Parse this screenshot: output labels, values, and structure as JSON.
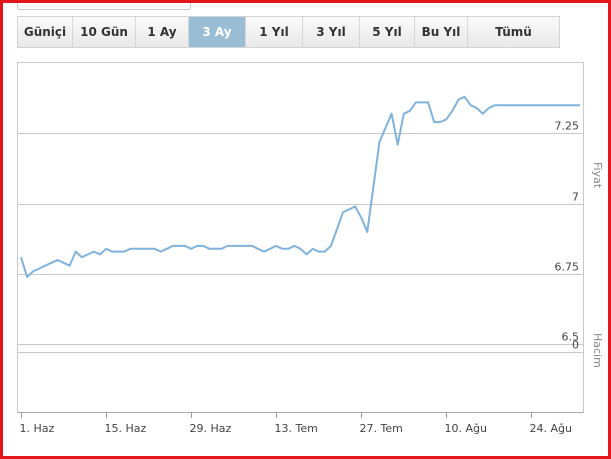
{
  "range_selector": {
    "buttons": [
      {
        "label": "Güniçi"
      },
      {
        "label": "10 Gün"
      },
      {
        "label": "1 Ay"
      },
      {
        "label": "3 Ay"
      },
      {
        "label": "1 Yıl"
      },
      {
        "label": "3 Yıl"
      },
      {
        "label": "5 Yıl"
      },
      {
        "label": "Bu Yıl"
      },
      {
        "label": "Tümü"
      }
    ],
    "active": "3 Ay"
  },
  "colors": {
    "line": "#7fb3dd",
    "active_button": "#98bdd4",
    "frame": "#e3161c",
    "grid": "#c8c8c8"
  },
  "side_labels": {
    "price_axis": "Fiyat",
    "volume_axis": "Hacim"
  },
  "chart_data": {
    "type": "line",
    "title": "",
    "xlabel": "",
    "ylabel": "Fiyat",
    "price_ticks": [
      {
        "label": "7.25",
        "value": 7.25
      },
      {
        "label": "7",
        "value": 7.0
      },
      {
        "label": "6.75",
        "value": 6.75
      },
      {
        "label": "6.5",
        "value": 6.5
      }
    ],
    "volume_ticks": [
      {
        "label": "0",
        "value": 0
      }
    ],
    "ylim": [
      6.26,
      7.5
    ],
    "x_ticks": [
      "1. Haz",
      "15. Haz",
      "29. Haz",
      "13. Tem",
      "27. Tem",
      "10. Ağu",
      "24. Ağu"
    ],
    "x_tick_days": [
      0,
      14,
      28,
      42,
      56,
      70,
      84
    ],
    "xlim_days": [
      -0.5,
      92.5
    ],
    "grid": true,
    "series": [
      {
        "days": [
          0,
          1,
          2,
          3,
          4,
          5,
          6,
          7,
          8,
          9,
          10,
          11,
          12,
          13,
          14,
          15,
          16,
          17,
          18,
          19,
          20,
          21,
          22,
          23,
          24,
          25,
          26,
          27,
          28,
          29,
          30,
          31,
          32,
          33,
          34,
          35,
          36,
          37,
          38,
          39,
          40,
          41,
          42,
          43,
          44,
          45,
          46,
          47,
          48,
          49,
          50,
          51,
          52,
          53,
          54,
          55,
          56,
          57,
          58,
          59,
          60,
          61,
          62,
          63,
          64,
          65,
          66,
          67,
          68,
          69,
          70,
          71,
          72,
          73,
          74,
          75,
          76,
          77,
          78,
          79,
          80,
          81,
          82,
          83,
          84,
          85,
          86,
          87,
          88,
          89,
          90,
          91,
          92
        ],
        "values": [
          6.81,
          6.74,
          6.76,
          6.77,
          6.78,
          6.79,
          6.8,
          6.79,
          6.78,
          6.83,
          6.81,
          6.82,
          6.83,
          6.82,
          6.84,
          6.83,
          6.83,
          6.83,
          6.84,
          6.84,
          6.84,
          6.84,
          6.84,
          6.83,
          6.84,
          6.85,
          6.85,
          6.85,
          6.84,
          6.85,
          6.85,
          6.84,
          6.84,
          6.84,
          6.85,
          6.85,
          6.85,
          6.85,
          6.85,
          6.84,
          6.83,
          6.84,
          6.85,
          6.84,
          6.84,
          6.85,
          6.84,
          6.82,
          6.84,
          6.83,
          6.83,
          6.85,
          6.91,
          6.97,
          6.98,
          6.99,
          6.95,
          6.9,
          7.06,
          7.22,
          7.27,
          7.32,
          7.21,
          7.32,
          7.33,
          7.36,
          7.36,
          7.36,
          7.29,
          7.29,
          7.3,
          7.33,
          7.37,
          7.38,
          7.35,
          7.34,
          7.32,
          7.34,
          7.35,
          7.35,
          7.35,
          7.35,
          7.35,
          7.35,
          7.35,
          7.35,
          7.35,
          7.35,
          7.35,
          7.35,
          7.35,
          7.35,
          7.35
        ]
      }
    ]
  }
}
